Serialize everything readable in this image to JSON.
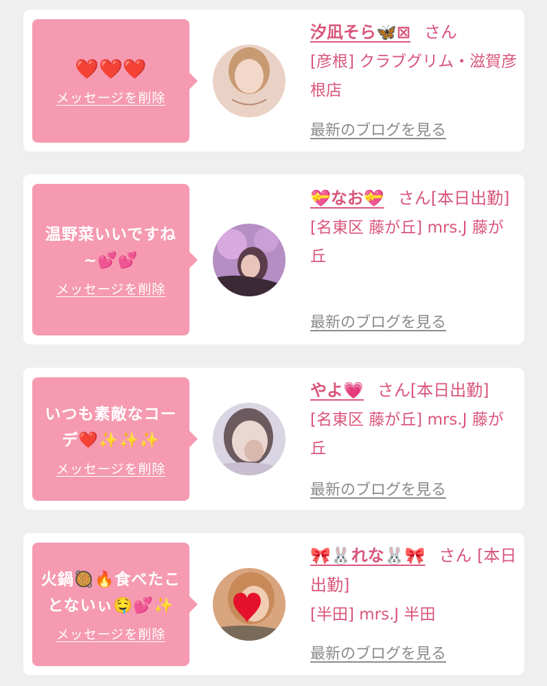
{
  "colors": {
    "accent_pink": "#d9557b",
    "bubble_pink": "#f59ab1",
    "blog_link_gray": "#8a8a8a",
    "background": "#efeff0"
  },
  "delete_label": "メッセージを削除",
  "blog_label": "最新のブログを見る",
  "items": [
    {
      "message": "❤️❤️❤️",
      "name": "汐凪そら🦋⊠",
      "san": "さん",
      "meta": "[彦根] クラブグリム・滋賀彦根店",
      "avatar_icon": "avatar-photo-icon"
    },
    {
      "message": "温野菜いいですね~💕💕",
      "name": "💝なお💝",
      "san": "さん[本日出勤]",
      "meta": "[名東区 藤が丘] mrs.J 藤が丘",
      "avatar_icon": "avatar-photo-icon"
    },
    {
      "message": "いつも素敵なコーデ❤️✨✨✨",
      "name": "やよ💗",
      "san": "さん[本日出勤]",
      "meta": "[名東区 藤が丘] mrs.J 藤が丘",
      "avatar_icon": "avatar-photo-icon"
    },
    {
      "message": "火鍋🥘🔥食べたことないぃ🤤💕✨",
      "name": "🎀🐰れな🐰🎀",
      "san": "さん [本日出勤]",
      "meta": "[半田] mrs.J 半田",
      "avatar_icon": "avatar-photo-icon"
    }
  ]
}
